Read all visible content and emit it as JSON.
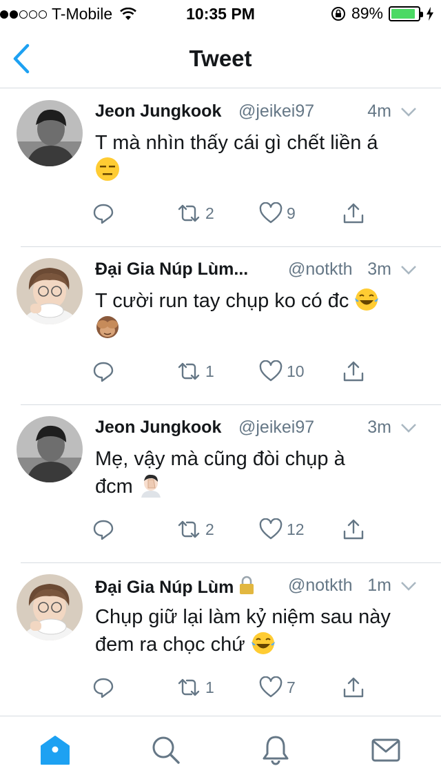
{
  "status_bar": {
    "carrier": "T-Mobile",
    "time": "10:35 PM",
    "battery": "89%",
    "battery_level": 0.89,
    "signal_bars": 2
  },
  "nav": {
    "title": "Tweet",
    "back_icon": "chevron-left-icon"
  },
  "colors": {
    "accent": "#1da1f2",
    "text": "#14171a",
    "secondary": "#657786",
    "divider": "#d6dbe0",
    "battery": "#4cd964"
  },
  "tweets": [
    {
      "name": "Jeon Jungkook",
      "handle": "@jeikei97",
      "time": "4m",
      "text_lines": [
        "T mà nhìn thấy cái gì chết liền á"
      ],
      "trailing_emoji": "expressionless-face-emoji",
      "protected": false,
      "replies": "",
      "retweets": "2",
      "likes": "9"
    },
    {
      "name": "Đại Gia Núp Lùm...",
      "handle": "@notkth",
      "time": "3m",
      "text_lines": [
        "T cười run tay chụp ko có đc"
      ],
      "trailing_emoji": "see-no-evil-monkey-emoji",
      "protected": false,
      "replies": "",
      "retweets": "1",
      "likes": "10"
    },
    {
      "name": "Jeon Jungkook",
      "handle": "@jeikei97",
      "time": "3m",
      "text_lines": [
        "Mẹ, vậy mà cũng đòi chụp à",
        "đcm"
      ],
      "trailing_emoji": "face-palm-emoji",
      "protected": false,
      "replies": "",
      "retweets": "2",
      "likes": "12"
    },
    {
      "name": "Đại Gia Núp Lùm",
      "handle": "@notkth",
      "time": "1m",
      "text_lines": [
        "Chụp giữ lại làm kỷ niệm sau này",
        "đem ra chọc chứ"
      ],
      "trailing_emoji": "tears-of-joy-emoji",
      "protected": true,
      "replies": "",
      "retweets": "1",
      "likes": "7"
    }
  ],
  "tab_bar": [
    {
      "name": "home",
      "icon": "home-icon",
      "active": true
    },
    {
      "name": "search",
      "icon": "search-icon",
      "active": false
    },
    {
      "name": "notifications",
      "icon": "bell-icon",
      "active": false
    },
    {
      "name": "messages",
      "icon": "envelope-icon",
      "active": false
    }
  ]
}
